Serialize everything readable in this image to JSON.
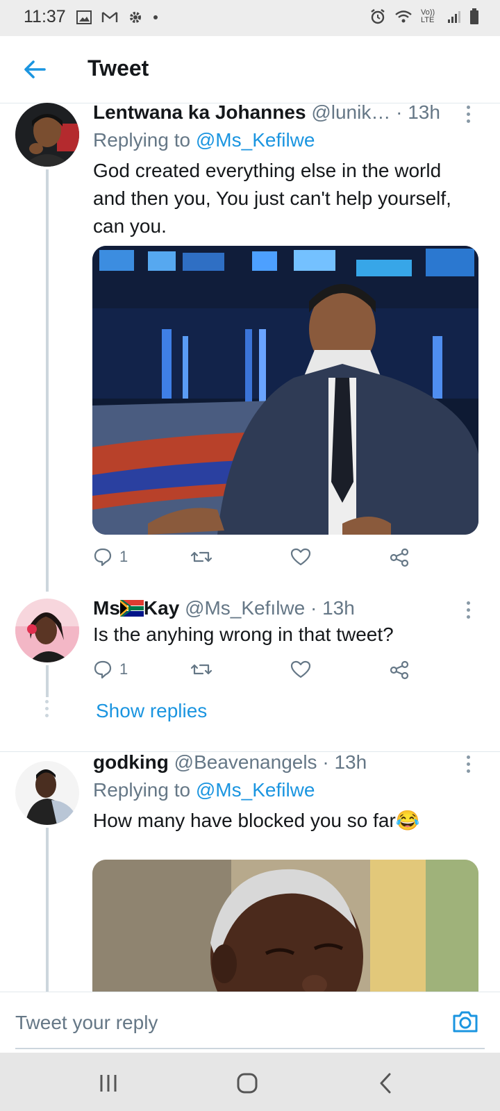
{
  "status_bar": {
    "time": "11:37",
    "lte_label": "Vo)) LTE"
  },
  "header": {
    "title": "Tweet"
  },
  "colors": {
    "accent": "#1b95e0",
    "secondary_text": "#657786",
    "divider": "#e1e8ed"
  },
  "tweets": [
    {
      "name": "Lentwana ka Johannes",
      "handle": "@lunik…",
      "time": "· 13h",
      "replying_prefix": "Replying to ",
      "replying_to": "@Ms_Kefilwe",
      "text_lines": [
        "God created everything else in the world",
        "and then you, You just can't help yourself,",
        "can you."
      ],
      "has_media": true,
      "reply_count": "1"
    },
    {
      "name_part1": "Ms",
      "name_part2": "Kay",
      "handle": "@Ms_Kefılwe",
      "time": "· 13h",
      "text": "Is the anyhing wrong in that tweet?",
      "reply_count": "1",
      "show_replies": "Show replies"
    },
    {
      "name": "godking",
      "handle": "@Beavenangels",
      "time": "· 13h",
      "replying_prefix": "Replying to ",
      "replying_to": "@Ms_Kefilwe",
      "text": "How many have blocked you so far",
      "emoji": "😂",
      "has_media": true
    }
  ],
  "composer": {
    "placeholder": "Tweet your reply"
  }
}
